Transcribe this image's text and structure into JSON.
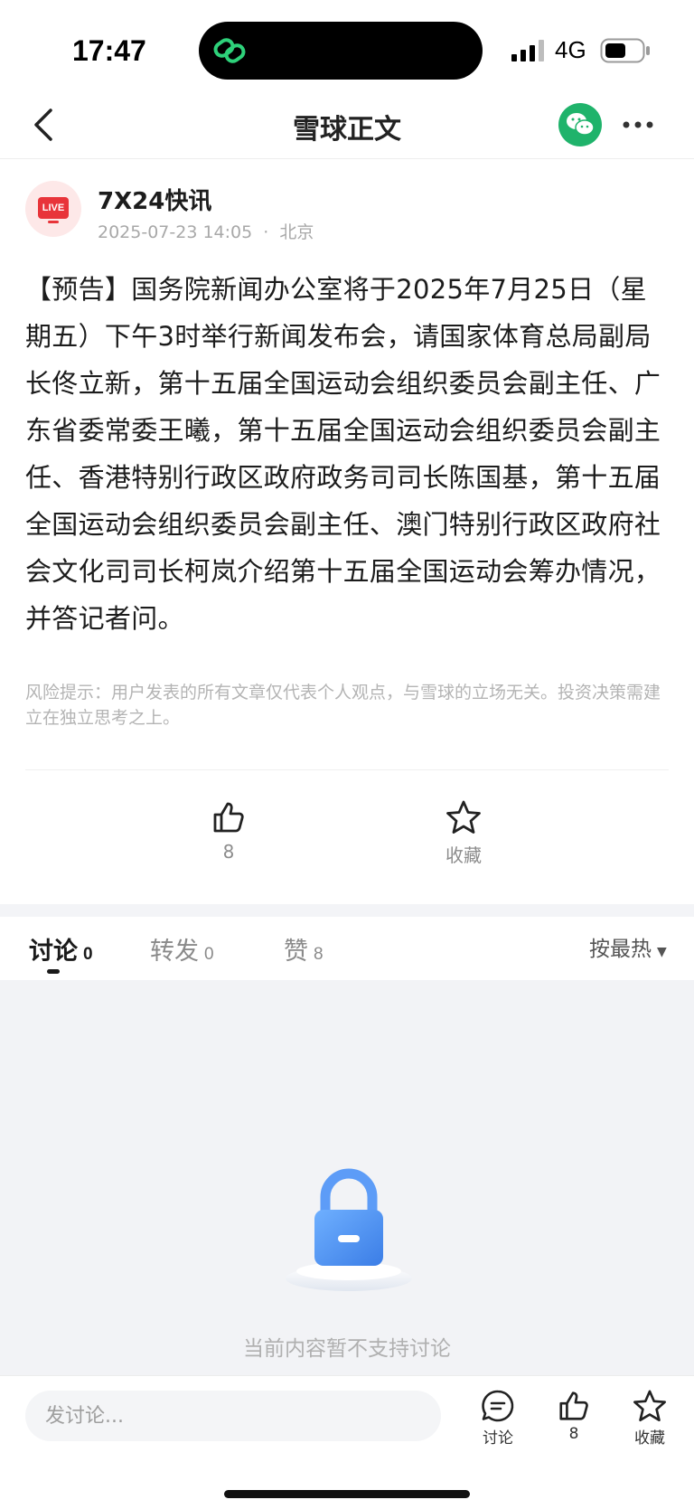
{
  "status_bar": {
    "time": "17:47",
    "network": "4G"
  },
  "nav": {
    "title": "雪球正文"
  },
  "author": {
    "badge": "LIVE",
    "name": "7X24快讯",
    "date": "2025-07-23 14:05",
    "separator": "·",
    "location": "北京"
  },
  "post": {
    "body": "【预告】国务院新闻办公室将于2025年7月25日（星期五）下午3时举行新闻发布会，请国家体育总局副局长佟立新，第十五届全国运动会组织委员会副主任、广东省委常委王曦，第十五届全国运动会组织委员会副主任、香港特别行政区政府政务司司长陈国基，第十五届全国运动会组织委员会副主任、澳门特别行政区政府社会文化司司长柯岚介绍第十五届全国运动会筹办情况，并答记者问。",
    "risk_notice": "风险提示：用户发表的所有文章仅代表个人观点，与雪球的立场无关。投资决策需建立在独立思考之上。"
  },
  "actions": {
    "like_count": "8",
    "favorite_label": "收藏"
  },
  "tabs": [
    {
      "label": "讨论",
      "count": "0"
    },
    {
      "label": "转发",
      "count": "0"
    },
    {
      "label": "赞",
      "count": "8"
    }
  ],
  "sort": {
    "label": "按最热"
  },
  "empty_state": {
    "text": "当前内容暂不支持讨论"
  },
  "bottom_bar": {
    "input_placeholder": "发讨论...",
    "discuss_label": "讨论",
    "like_count": "8",
    "favorite_label": "收藏"
  },
  "colors": {
    "wechat_green": "#1fb36b",
    "live_red": "#e8343a",
    "lock_blue": "#4a8ff0"
  }
}
